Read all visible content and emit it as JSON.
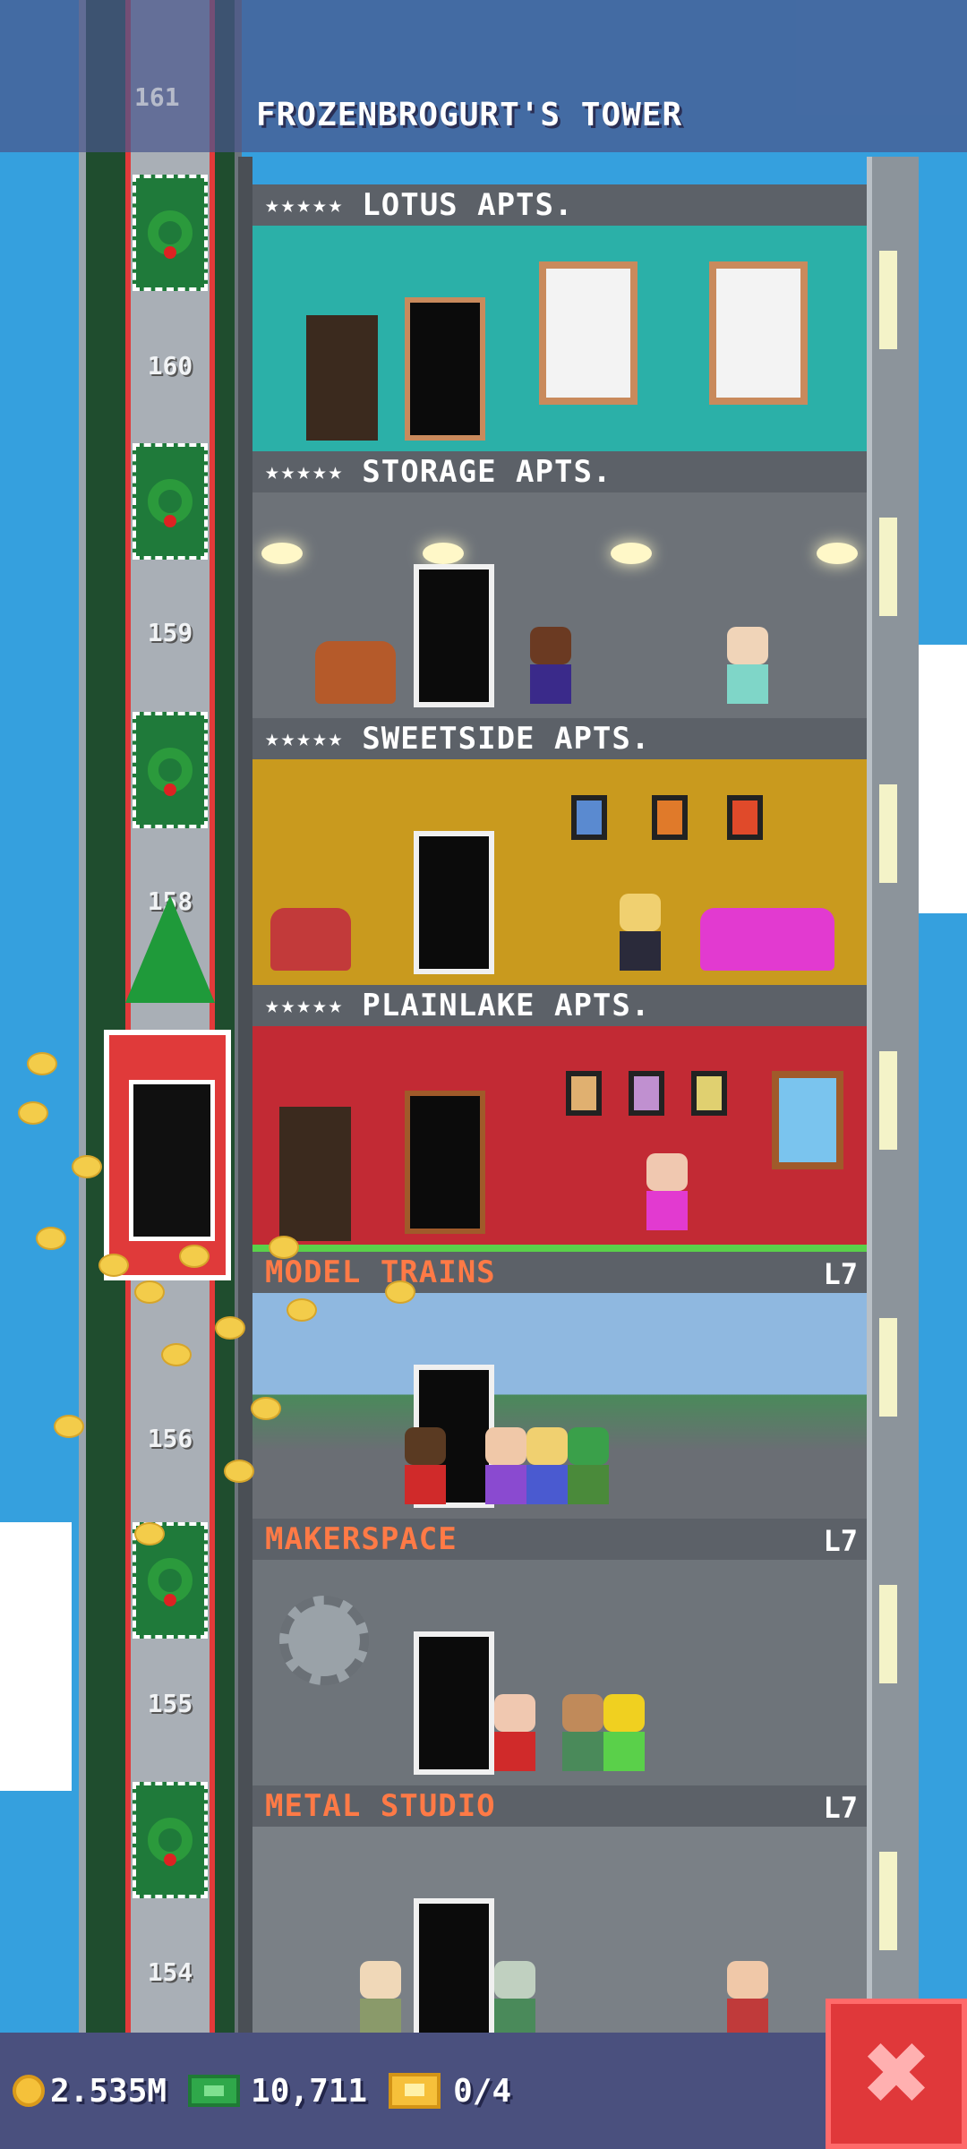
{
  "tower": {
    "title": "FROZENBROGURT'S TOWER"
  },
  "elevator_floors": [
    "161",
    "160",
    "159",
    "158",
    "156",
    "155",
    "154"
  ],
  "floors": [
    {
      "stars": "★★★★★",
      "name": "LOTUS APTS.",
      "level": ""
    },
    {
      "stars": "★★★★★",
      "name": "STORAGE APTS.",
      "level": ""
    },
    {
      "stars": "★★★★★",
      "name": "SWEETSIDE APTS.",
      "level": ""
    },
    {
      "stars": "★★★★★",
      "name": "PLAINLAKE APTS.",
      "level": ""
    },
    {
      "stars": "",
      "name": "MODEL TRAINS",
      "level": "L7"
    },
    {
      "stars": "",
      "name": "MAKERSPACE",
      "level": "L7"
    },
    {
      "stars": "",
      "name": "METAL STUDIO",
      "level": "L7"
    }
  ],
  "status": {
    "coins": "2.535M",
    "bux": "10,711",
    "tickets": "0/4"
  },
  "controls": {
    "close_icon": "close-icon",
    "close_glyph": "✖"
  },
  "colors": {
    "accent_red": "#e0383a",
    "business_title": "#ff7a46",
    "bar": "#4a507e"
  }
}
